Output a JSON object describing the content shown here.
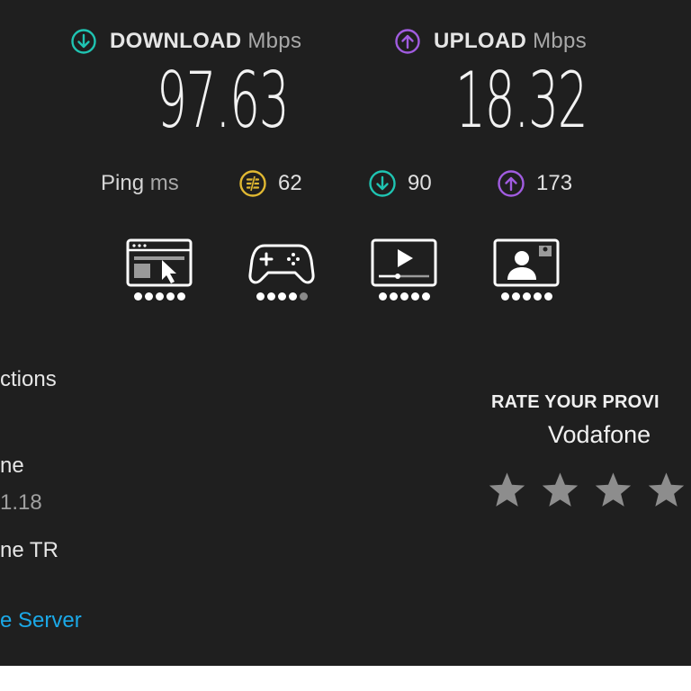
{
  "download": {
    "label": "DOWNLOAD",
    "unit": "Mbps",
    "value": "97.63",
    "color": "#1fc4b2"
  },
  "upload": {
    "label": "UPLOAD",
    "unit": "Mbps",
    "value": "18.32",
    "color": "#a15ce0"
  },
  "ping": {
    "label": "Ping",
    "unit": "ms",
    "idle": "62",
    "download": "90",
    "upload": "173",
    "idle_color": "#e0b832"
  },
  "usage": [
    {
      "name": "web-browsing-icon",
      "rating": 5
    },
    {
      "name": "gaming-icon",
      "rating": 4
    },
    {
      "name": "video-streaming-icon",
      "rating": 5
    },
    {
      "name": "video-chat-icon",
      "rating": 5
    }
  ],
  "connections": {
    "title_partial": "ctions",
    "provider_partial": "ne",
    "ip_partial": "1.18",
    "server_partial": "ne TR",
    "change_server_partial": "e Server"
  },
  "rating": {
    "title": "RATE YOUR PROVI",
    "provider": "Vodafone",
    "stars_visible": 4,
    "star_color": "#8d8d8d"
  }
}
